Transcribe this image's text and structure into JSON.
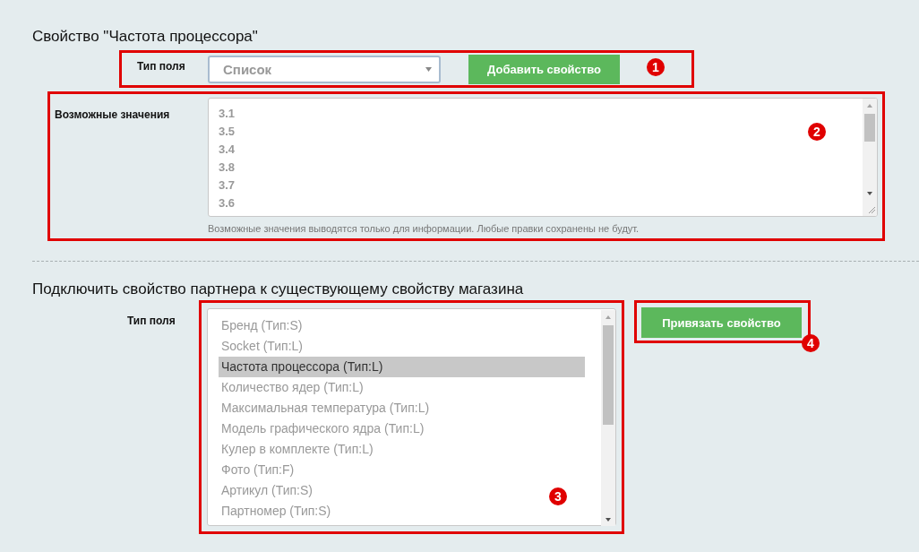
{
  "property_section": {
    "title": "Свойство \"Частота процессора\"",
    "field_type": {
      "label": "Тип поля",
      "value": "Список"
    },
    "add_button": "Добавить свойство",
    "values_field": {
      "label": "Возможные значения",
      "values": [
        "3.1",
        "3.5",
        "3.4",
        "3.8",
        "3.7",
        "3.6"
      ],
      "hint": "Возможные значения выводятся только для информации. Любые правки сохранены не будут."
    }
  },
  "link_section": {
    "title": "Подключить свойство партнера к существующему свойству магазина",
    "field_type_label": "Тип поля",
    "options": [
      {
        "label": "Бренд (Тип:S)",
        "selected": false
      },
      {
        "label": "Socket (Тип:L)",
        "selected": false
      },
      {
        "label": "Частота процессора (Тип:L)",
        "selected": true
      },
      {
        "label": "Количество ядер (Тип:L)",
        "selected": false
      },
      {
        "label": "Максимальная температура (Тип:L)",
        "selected": false
      },
      {
        "label": "Модель графического ядра (Тип:L)",
        "selected": false
      },
      {
        "label": "Кулер в комплекте (Тип:L)",
        "selected": false
      },
      {
        "label": "Фото (Тип:F)",
        "selected": false
      },
      {
        "label": "Артикул (Тип:S)",
        "selected": false
      },
      {
        "label": "Партномер (Тип:S)",
        "selected": false
      }
    ],
    "link_button": "Привязать свойство"
  },
  "annotations": [
    "1",
    "2",
    "3",
    "4"
  ]
}
